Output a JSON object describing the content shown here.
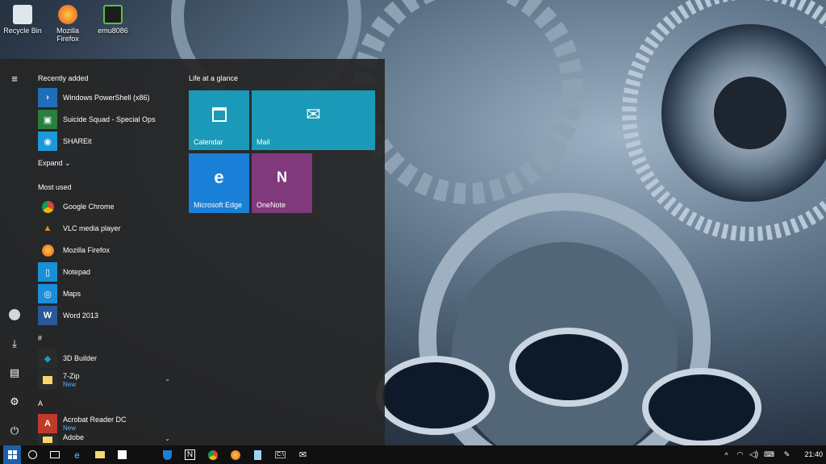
{
  "desktop": {
    "icons": [
      {
        "label": "Recycle Bin"
      },
      {
        "label": "Mozilla Firefox"
      },
      {
        "label": "emu8086"
      }
    ]
  },
  "start_menu": {
    "recently_added_title": "Recently added",
    "recently_added": [
      {
        "label": "Windows PowerShell (x86)",
        "icon": "powershell-icon",
        "color": "#1e6fb8"
      },
      {
        "label": "Suicide Squad - Special Ops",
        "icon": "game-icon",
        "color": "#2a7f3a"
      },
      {
        "label": "SHAREit",
        "icon": "shareit-icon",
        "color": "#1a9ad6"
      }
    ],
    "expand_label": "Expand",
    "most_used_title": "Most used",
    "most_used": [
      {
        "label": "Google Chrome",
        "icon": "chrome-icon",
        "color": "#2b2b2b"
      },
      {
        "label": "VLC media player",
        "icon": "vlc-icon",
        "color": "#2b2b2b"
      },
      {
        "label": "Mozilla Firefox",
        "icon": "firefox-icon",
        "color": "#2b2b2b"
      },
      {
        "label": "Notepad",
        "icon": "notepad-icon",
        "color": "#1a8fd6"
      },
      {
        "label": "Maps",
        "icon": "maps-icon",
        "color": "#1a8fd6"
      },
      {
        "label": "Word 2013",
        "icon": "word-icon",
        "color": "#2b5797"
      }
    ],
    "hash_header": "#",
    "hash_apps": [
      {
        "label": "3D Builder",
        "icon": "3d-builder-icon",
        "color": "#2b2b2b"
      },
      {
        "label": "7-Zip",
        "sub": "New",
        "icon": "folder-icon",
        "color": "#2b2b2b"
      }
    ],
    "a_header": "A",
    "a_apps": [
      {
        "label": "Acrobat Reader DC",
        "sub": "New",
        "icon": "acrobat-icon",
        "color": "#c0392b"
      },
      {
        "label": "Adobe",
        "icon": "folder-icon",
        "color": "#2b2b2b"
      }
    ],
    "group_title": "Life at a glance",
    "tiles": [
      {
        "label": "Calendar",
        "icon": "calendar-icon",
        "color": "#1a9ab8"
      },
      {
        "label": "Mail",
        "icon": "mail-icon",
        "color": "#1a9ab8"
      },
      {
        "label": "Microsoft Edge",
        "icon": "edge-icon",
        "color": "#1a7fd6"
      },
      {
        "label": "OneNote",
        "icon": "onenote-icon",
        "color": "#80397b"
      }
    ]
  },
  "taskbar": {
    "clock": "21:40"
  }
}
